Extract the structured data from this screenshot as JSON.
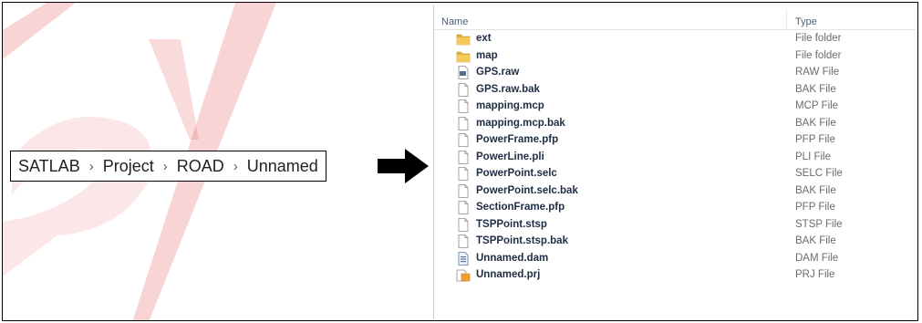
{
  "breadcrumb": {
    "items": [
      "SATLAB",
      "Project",
      "ROAD",
      "Unnamed"
    ],
    "separator": "›"
  },
  "explorer": {
    "columns": {
      "name": "Name",
      "type": "Type"
    },
    "files": [
      {
        "name": "ext",
        "type": "File folder",
        "icon": "folder-icon"
      },
      {
        "name": "map",
        "type": "File folder",
        "icon": "folder-icon"
      },
      {
        "name": "GPS.raw",
        "type": "RAW File",
        "icon": "raw-file-icon"
      },
      {
        "name": "GPS.raw.bak",
        "type": "BAK File",
        "icon": "file-icon"
      },
      {
        "name": "mapping.mcp",
        "type": "MCP File",
        "icon": "file-icon"
      },
      {
        "name": "mapping.mcp.bak",
        "type": "BAK File",
        "icon": "file-icon"
      },
      {
        "name": "PowerFrame.pfp",
        "type": "PFP File",
        "icon": "file-icon"
      },
      {
        "name": "PowerLine.pli",
        "type": "PLI File",
        "icon": "file-icon"
      },
      {
        "name": "PowerPoint.selc",
        "type": "SELC File",
        "icon": "file-icon"
      },
      {
        "name": "PowerPoint.selc.bak",
        "type": "BAK File",
        "icon": "file-icon"
      },
      {
        "name": "SectionFrame.pfp",
        "type": "PFP File",
        "icon": "file-icon"
      },
      {
        "name": "TSPPoint.stsp",
        "type": "STSP File",
        "icon": "file-icon"
      },
      {
        "name": "TSPPoint.stsp.bak",
        "type": "BAK File",
        "icon": "file-icon"
      },
      {
        "name": "Unnamed.dam",
        "type": "DAM File",
        "icon": "dam-file-icon"
      },
      {
        "name": "Unnamed.prj",
        "type": "PRJ File",
        "icon": "prj-file-icon"
      }
    ]
  },
  "colors": {
    "watermark": "#e23a3a",
    "folder": "#e6b13a",
    "header_text": "#4c607a",
    "file_name": "#1e2d45",
    "file_type": "#6b6b6b"
  }
}
